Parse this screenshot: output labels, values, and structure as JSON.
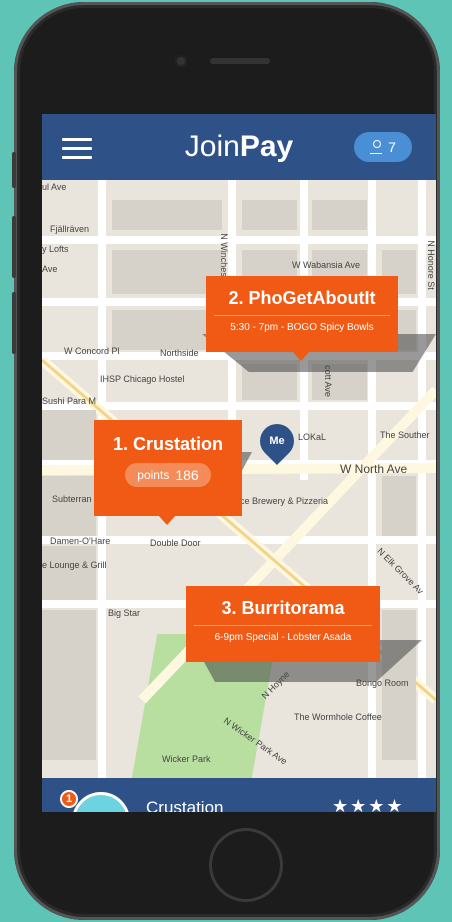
{
  "app": {
    "logo_part1": "Join",
    "logo_part2": "Pay",
    "user_count": "7"
  },
  "map_labels": [
    "ul Ave",
    "Fjällräven",
    "y Lofts",
    "Ave",
    "W Wabansia Ave",
    "W Concord Pl",
    "Northside",
    "IHSP Chicago Hostel",
    "Sushi Para M",
    "LOKaL",
    "The Souther",
    "W North Ave",
    "Subterran",
    "ce Brewery & Pizzeria",
    "Damen-O'Hare",
    "Double Door",
    "e Lounge & Grill",
    "Big Star",
    "N Elk Grove Av",
    "Bongo Room",
    "The Wormhole Coffee",
    "N Wicker Park Ave",
    "Wicker Park",
    "N Hoyne",
    "N Winches",
    "cott Ave",
    "N Honore St"
  ],
  "callouts": {
    "c1": {
      "title": "1. Crustation",
      "points_label": "points",
      "points_value": "186"
    },
    "c2": {
      "title": "2. PhoGetAboutIt",
      "subtitle": "5:30 - 7pm - BOGO Spicy Bowls"
    },
    "c3": {
      "title": "3. Burritorama",
      "subtitle": "6-9pm Special - Lobster Asada"
    }
  },
  "me_pin_label": "Me",
  "bottom": {
    "badge": "1",
    "name": "Crustation",
    "stars": "★★★★"
  },
  "colors": {
    "nav": "#2e5188",
    "accent": "#f05a14",
    "background": "#5ec4b6"
  }
}
